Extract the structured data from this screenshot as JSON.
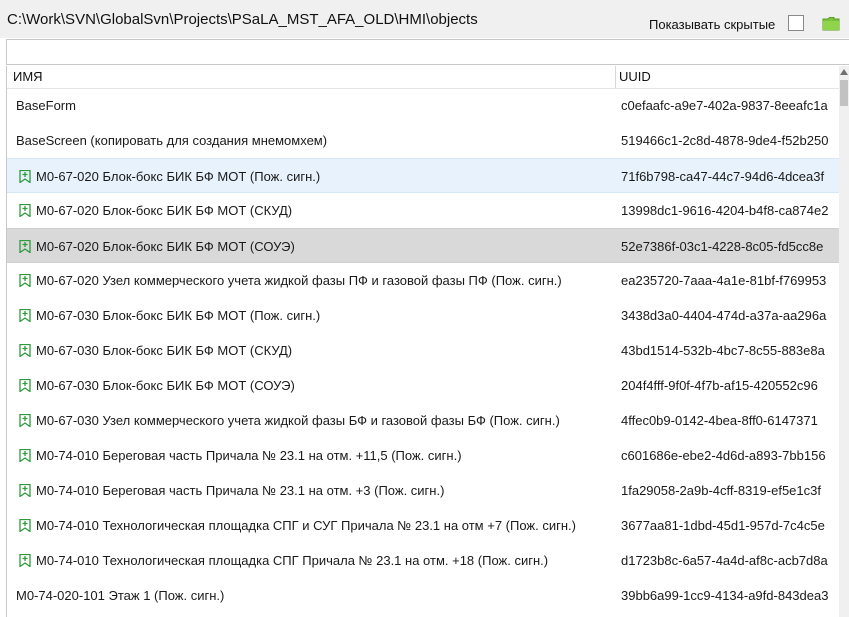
{
  "toolbar": {
    "path": "C:\\Work\\SVN\\GlobalSvn\\Projects\\PSaLA_MST_AFA_OLD\\HMI\\objects",
    "show_hidden_label": "Показывать скрытые",
    "show_hidden_checked": false,
    "folder_icon": "folder-icon"
  },
  "search": {
    "value": "",
    "placeholder": ""
  },
  "table": {
    "columns": [
      "ИМЯ",
      "UUID"
    ],
    "rows": [
      {
        "name": "BaseForm",
        "uuid": "c0efaafc-a9e7-402a-9837-8eeafc1a",
        "icon": null,
        "state": "normal"
      },
      {
        "name": "BaseScreen (копировать для создания мнемомхем)",
        "uuid": "519466c1-2c8d-4878-9de4-f52b250",
        "icon": null,
        "state": "normal"
      },
      {
        "name": "М0-67-020 Блок-бокс БИК БФ МОТ (Пож. сигн.)",
        "uuid": "71f6b798-ca47-44c7-94d6-4dcea3f",
        "icon": "bookmark-plus-icon",
        "state": "hover"
      },
      {
        "name": "М0-67-020 Блок-бокс БИК БФ МОТ (СКУД)",
        "uuid": "13998dc1-9616-4204-b4f8-ca874e2",
        "icon": "bookmark-plus-icon",
        "state": "normal"
      },
      {
        "name": "М0-67-020 Блок-бокс БИК БФ МОТ (СОУЭ)",
        "uuid": "52e7386f-03c1-4228-8c05-fd5cc8e",
        "icon": "bookmark-plus-icon",
        "state": "selected"
      },
      {
        "name": "М0-67-020 Узел коммерческого учета жидкой фазы ПФ и газовой фазы ПФ (Пож. сигн.)",
        "uuid": "ea235720-7aaa-4a1e-81bf-f769953",
        "icon": "bookmark-plus-icon",
        "state": "normal"
      },
      {
        "name": "М0-67-030 Блок-бокс БИК БФ МОТ (Пож. сигн.)",
        "uuid": "3438d3a0-4404-474d-a37a-aa296a",
        "icon": "bookmark-plus-icon",
        "state": "normal"
      },
      {
        "name": "М0-67-030 Блок-бокс БИК БФ МОТ (СКУД)",
        "uuid": "43bd1514-532b-4bc7-8c55-883e8a",
        "icon": "bookmark-plus-icon",
        "state": "normal"
      },
      {
        "name": "М0-67-030 Блок-бокс БИК БФ МОТ (СОУЭ)",
        "uuid": "204f4fff-9f0f-4f7b-af15-420552c96",
        "icon": "bookmark-plus-icon",
        "state": "normal"
      },
      {
        "name": "М0-67-030 Узел коммерческого учета жидкой фазы БФ и газовой фазы БФ (Пож. сигн.)",
        "uuid": "4ffec0b9-0142-4bea-8ff0-6147371",
        "icon": "bookmark-plus-icon",
        "state": "normal"
      },
      {
        "name": "М0-74-010 Береговая часть Причала № 23.1 на отм. +11,5 (Пож. сигн.)",
        "uuid": "c601686e-ebe2-4d6d-a893-7bb156",
        "icon": "bookmark-plus-icon",
        "state": "normal"
      },
      {
        "name": "М0-74-010 Береговая часть Причала № 23.1 на отм. +3 (Пож. сигн.)",
        "uuid": "1fa29058-2a9b-4cff-8319-ef5e1c3f",
        "icon": "bookmark-plus-icon",
        "state": "normal"
      },
      {
        "name": "М0-74-010 Технологическая площадка СПГ и СУГ Причала № 23.1 на отм +7 (Пож. сигн.)",
        "uuid": "3677aa81-1dbd-45d1-957d-7c4c5e",
        "icon": "bookmark-plus-icon",
        "state": "normal"
      },
      {
        "name": "М0-74-010 Технологическая площадка СПГ Причала № 23.1 на отм. +18 (Пож. сигн.)",
        "uuid": "d1723b8c-6a57-4a4d-af8c-acb7d8a",
        "icon": "bookmark-plus-icon",
        "state": "normal"
      },
      {
        "name": "М0-74-020-101 Этаж 1 (Пож. сигн.)",
        "uuid": "39bb6a99-1cc9-4134-a9fd-843dea3",
        "icon": null,
        "state": "normal"
      }
    ]
  },
  "colors": {
    "icon_green": "#2e9a3c",
    "hover_bg": "#e8f2fc",
    "selected_bg": "#d9d9d9",
    "folder": "#7cc43c"
  }
}
